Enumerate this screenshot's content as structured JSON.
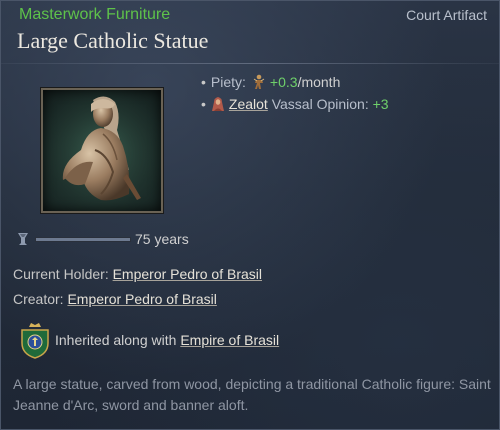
{
  "header": {
    "category": "Masterwork Furniture",
    "rarity": "Court Artifact",
    "title": "Large Catholic Statue"
  },
  "modifiers": [
    {
      "label": "Piety:",
      "value": "+0.3",
      "suffix": "/month",
      "icon": "piety-icon"
    },
    {
      "link": "Zealot",
      "label": "Vassal Opinion:",
      "value": "+3",
      "icon": "zealot-trait-icon"
    }
  ],
  "durability": {
    "icon": "durability-icon",
    "text": "75 years",
    "fill_fraction": 1.0
  },
  "holder": {
    "label": "Current Holder:",
    "name": "Emperor Pedro of Brasil"
  },
  "creator": {
    "label": "Creator:",
    "name": "Emperor Pedro of Brasil"
  },
  "inheritance": {
    "icon": "brasil-coat-of-arms-icon",
    "text": "Inherited along with",
    "title": "Empire of Brasil"
  },
  "description": "A large statue, carved from wood, depicting a traditional Catholic figure: Saint Jeanne d'Arc, sword and banner aloft.",
  "colors": {
    "category": "#5ec24a",
    "positive_value": "#6fd06a",
    "background": "#222b39"
  }
}
